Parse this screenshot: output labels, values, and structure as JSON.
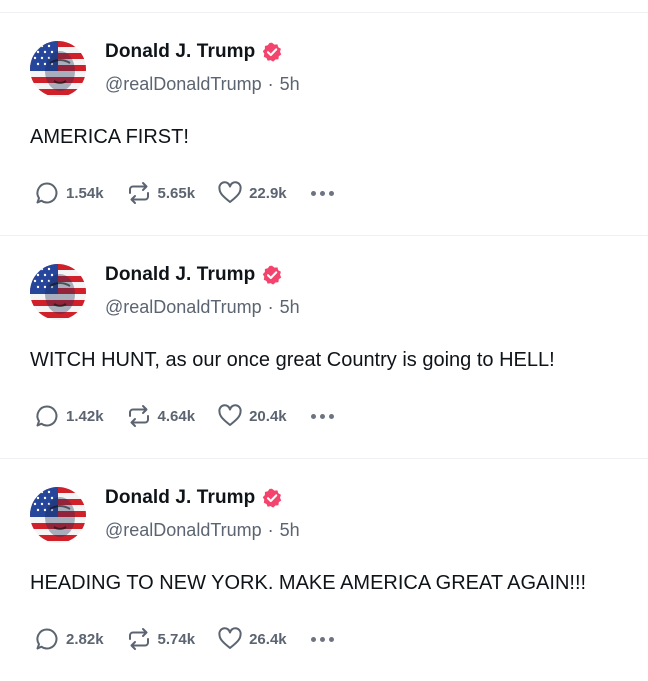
{
  "posts": [
    {
      "author": {
        "display_name": "Donald J. Trump",
        "handle": "@realDonaldTrump",
        "time": "5h"
      },
      "text": "AMERICA FIRST!",
      "stats": {
        "replies": "1.54k",
        "reposts": "5.65k",
        "likes": "22.9k"
      }
    },
    {
      "author": {
        "display_name": "Donald J. Trump",
        "handle": "@realDonaldTrump",
        "time": "5h"
      },
      "text": "WITCH HUNT, as our once great Country is going to HELL!",
      "stats": {
        "replies": "1.42k",
        "reposts": "4.64k",
        "likes": "20.4k"
      }
    },
    {
      "author": {
        "display_name": "Donald J. Trump",
        "handle": "@realDonaldTrump",
        "time": "5h"
      },
      "text": "HEADING TO NEW YORK. MAKE AMERICA GREAT AGAIN!!!",
      "stats": {
        "replies": "2.82k",
        "reposts": "5.74k",
        "likes": "26.4k"
      }
    }
  ],
  "icons": {
    "avatar": "flag-portrait-avatar",
    "verified": "verified-badge-icon",
    "reply": "reply-bubble-icon",
    "repost": "repost-arrows-icon",
    "like": "heart-icon",
    "more": "more-dots-icon"
  },
  "colors": {
    "verified": "#f4436c",
    "text": "#0f1419",
    "muted": "#5b6470",
    "flag_red": "#d0212b",
    "flag_blue": "#26469c"
  }
}
